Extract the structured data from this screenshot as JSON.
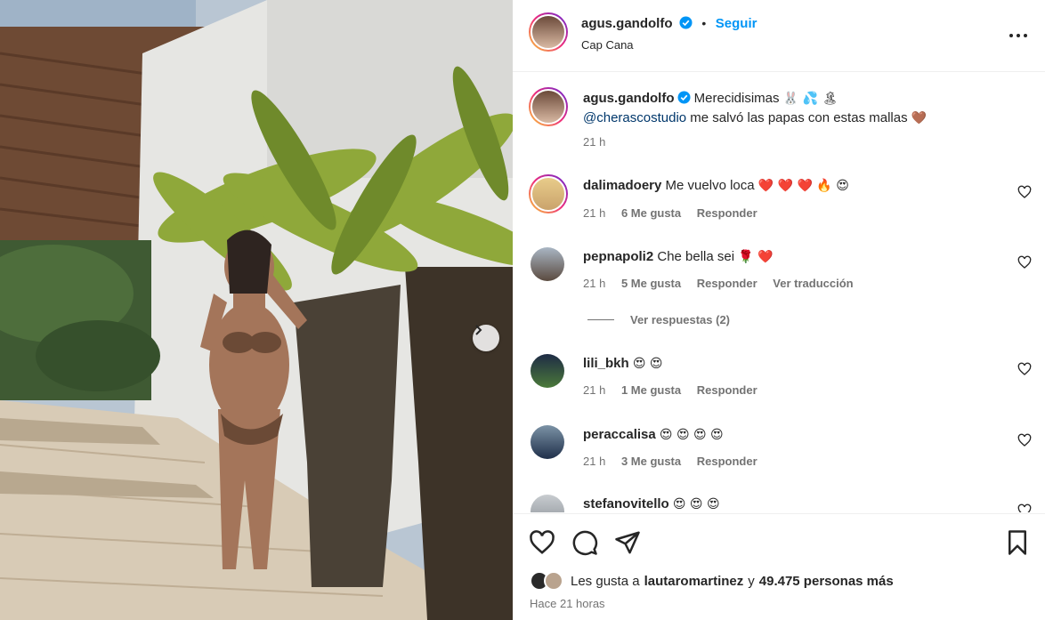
{
  "post": {
    "author": "agus.gandolfo",
    "follow_label": "Seguir",
    "location": "Cap Cana",
    "caption_text": "Merecidisimas",
    "caption_emojis": "🐰 💦 🏝",
    "caption_mention": "@cherascostudio",
    "caption_rest": "me salvó las papas con estas mallas",
    "caption_emoji2": "🤎",
    "caption_time": "21 h"
  },
  "comments": [
    {
      "user": "dalimadoery",
      "text": "Me vuelvo loca",
      "emojis": "❤️ ❤️ ❤️ 🔥 😍",
      "time": "21 h",
      "likes": "6 Me gusta",
      "reply": "Responder",
      "translate": ""
    },
    {
      "user": "pepnapoli2",
      "text": "Che bella sei",
      "emojis": "🌹 ❤️",
      "time": "21 h",
      "likes": "5 Me gusta",
      "reply": "Responder",
      "translate": "Ver traducción"
    },
    {
      "user": "lili_bkh",
      "text": "",
      "emojis": "😍 😍",
      "time": "21 h",
      "likes": "1 Me gusta",
      "reply": "Responder",
      "translate": ""
    },
    {
      "user": "peraccalisa",
      "text": "",
      "emojis": "😍 😍 😍 😍",
      "time": "21 h",
      "likes": "3 Me gusta",
      "reply": "Responder",
      "translate": ""
    },
    {
      "user": "stefanovitello",
      "text": "",
      "emojis": "😍 😍 😍",
      "time": "",
      "likes": "",
      "reply": "",
      "translate": ""
    }
  ],
  "view_replies": "Ver respuestas (2)",
  "likes_bar": {
    "prefix": "Les gusta a",
    "liker": "lautaromartinez",
    "connector": "y",
    "others": "49.475 personas más",
    "time_ago": "Hace 21 horas"
  },
  "icons": [
    "verified-icon",
    "more-icon",
    "heart-icon",
    "comment-icon",
    "share-icon",
    "bookmark-icon",
    "chevron-right-icon"
  ],
  "colors": {
    "accent": "#0095f6",
    "mention": "#00376b",
    "meta": "#737373",
    "text": "#262626"
  }
}
